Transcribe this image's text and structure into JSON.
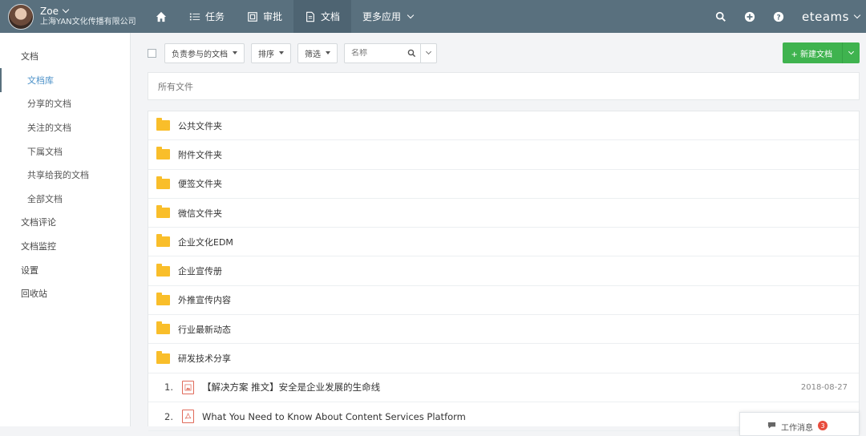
{
  "user": {
    "name": "Zoe",
    "org": "上海YAN文化传播有限公司"
  },
  "nav": {
    "items": [
      {
        "label": "任务"
      },
      {
        "label": "审批"
      },
      {
        "label": "文档"
      },
      {
        "label": "更多应用"
      }
    ],
    "brand": "eteams"
  },
  "sidebar": {
    "items": [
      {
        "label": "文档"
      },
      {
        "label": "文档库"
      },
      {
        "label": "分享的文档"
      },
      {
        "label": "关注的文档"
      },
      {
        "label": "下属文档"
      },
      {
        "label": "共享给我的文档"
      },
      {
        "label": "全部文档"
      },
      {
        "label": "文档评论"
      },
      {
        "label": "文档监控"
      },
      {
        "label": "设置"
      },
      {
        "label": "回收站"
      }
    ]
  },
  "toolbar": {
    "filter_label": "负责参与的文档",
    "sort_label": "排序",
    "screen_label": "筛选",
    "search_placeholder": "名称",
    "new_label": "+ 新建文档"
  },
  "breadcrumb": "所有文件",
  "folders": [
    "公共文件夹",
    "附件文件夹",
    "便签文件夹",
    "微信文件夹",
    "企业文化EDM",
    "企业宣传册",
    "外推宣传内容",
    "行业最新动态",
    "研发技术分享"
  ],
  "documents": [
    {
      "index": "1.",
      "title": "【解决方案 推文】安全是企业发展的生命线",
      "date": "2018-08-27"
    },
    {
      "index": "2.",
      "title": "What You Need to Know About Content Services Platform",
      "date": ""
    }
  ],
  "message_tab": {
    "label": "工作消息",
    "count": "3"
  },
  "colors": {
    "topbar": "#59707e",
    "accent": "#3fb34f",
    "folder": "#f9be2a"
  }
}
